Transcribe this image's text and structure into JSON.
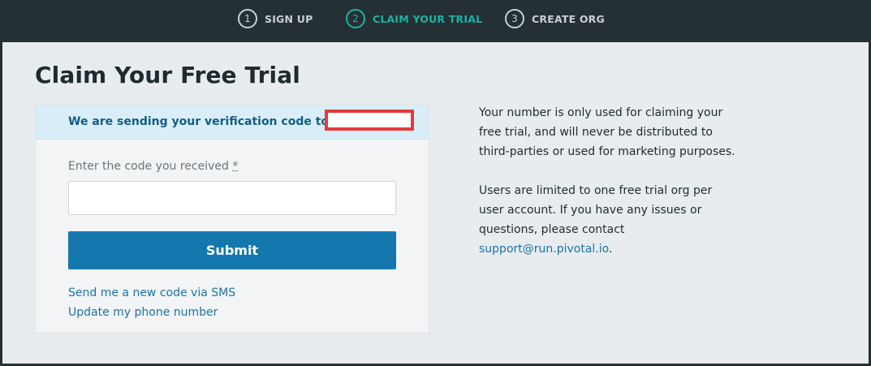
{
  "steps": [
    {
      "number": "1",
      "label": "SIGN UP"
    },
    {
      "number": "2",
      "label": "CLAIM YOUR TRIAL"
    },
    {
      "number": "3",
      "label": "CREATE ORG"
    }
  ],
  "active_step_color": "#1bb3a4",
  "page_title": "Claim Your Free Trial",
  "notice": {
    "text": "We are sending your verification code to +9199"
  },
  "form": {
    "code_label": "Enter the code you received",
    "required_marker": "*",
    "code_value": "",
    "submit_label": "Submit"
  },
  "links": {
    "resend_sms": "Send me a new code via SMS",
    "update_phone": "Update my phone number"
  },
  "info": {
    "paragraph_1": "Your number is only used for claiming your free trial, and will never be distributed to third-parties or used for marketing purposes.",
    "paragraph_2_prefix": "Users are limited to one free trial org per user account. If you have any issues or questions, please contact ",
    "support_email": "support@run.pivotal.io",
    "paragraph_2_suffix": "."
  },
  "colors": {
    "header_bg": "#243034",
    "primary_button": "#1478ae",
    "link": "#1a74a7",
    "notice_bg": "#d9eef8",
    "redaction_border": "#e53a3a"
  }
}
